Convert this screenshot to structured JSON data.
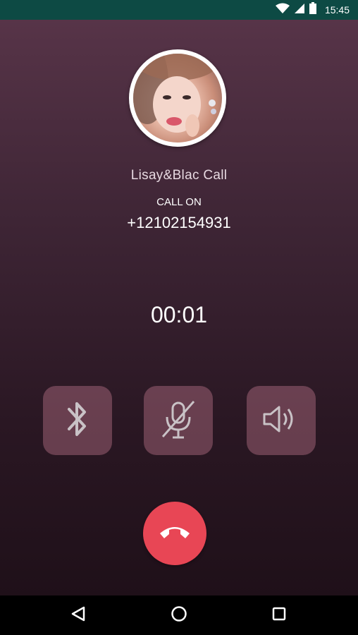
{
  "status_bar": {
    "time": "15:45",
    "icons": [
      "wifi-icon",
      "signal-icon",
      "battery-icon"
    ],
    "background": "#0d4a44"
  },
  "call": {
    "caller_name": "Lisay&Blac Call",
    "status": "CALL ON",
    "number": "+12102154931",
    "duration": "00:01"
  },
  "controls": [
    {
      "name": "bluetooth",
      "icon": "bluetooth-icon"
    },
    {
      "name": "mute",
      "icon": "mic-off-icon"
    },
    {
      "name": "speaker",
      "icon": "speaker-icon"
    }
  ],
  "end_call": {
    "icon": "phone-hangup-icon",
    "color": "#e84655"
  },
  "nav_bar": {
    "buttons": [
      "back-icon",
      "home-icon",
      "recents-icon"
    ]
  },
  "colors": {
    "accent": "#e84655",
    "control_bg": "#8a5266",
    "text": "#ffffff"
  }
}
